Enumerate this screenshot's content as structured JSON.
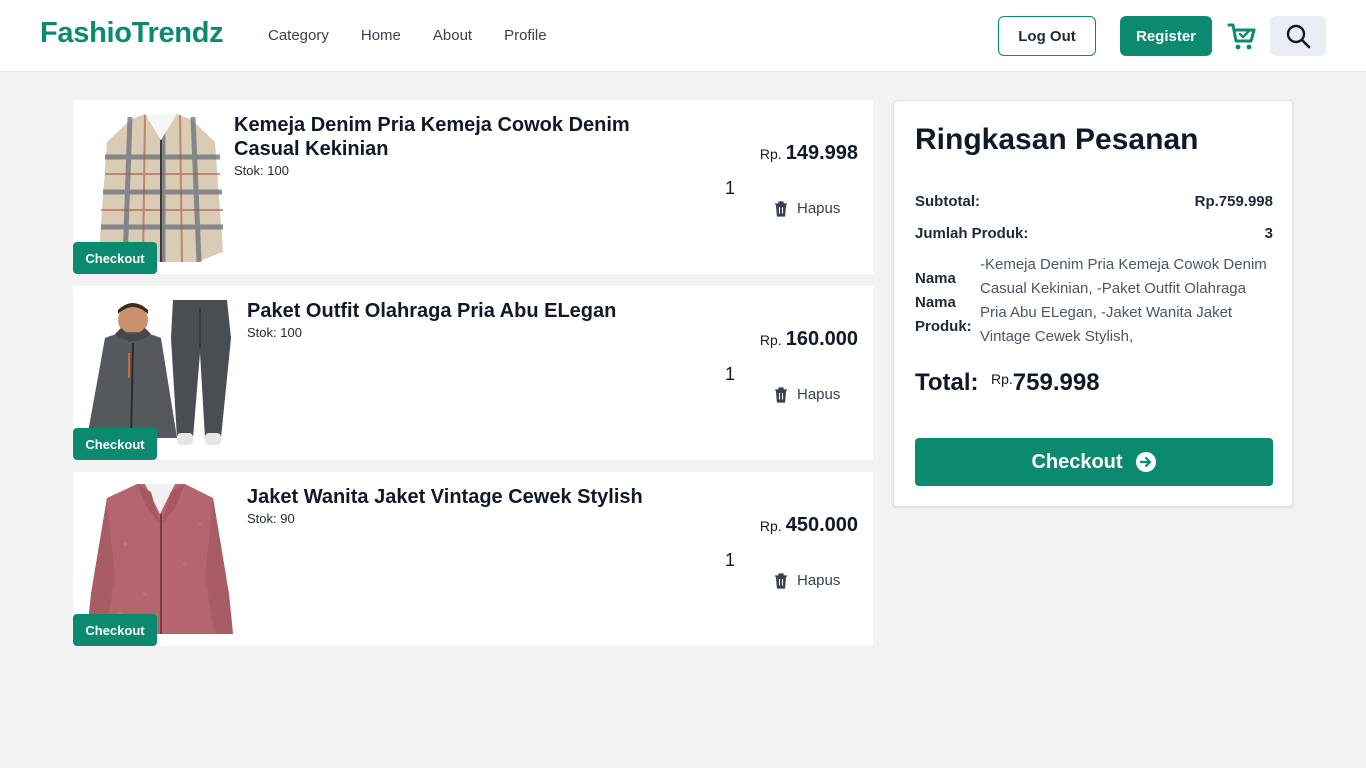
{
  "header": {
    "logo": "FashioTrendz",
    "nav": [
      "Category",
      "Home",
      "About",
      "Profile"
    ],
    "logout_label": "Log Out",
    "register_label": "Register",
    "cart_icon": "cart-icon",
    "search_icon": "search-icon"
  },
  "items": [
    {
      "title": "Kemeja Denim Pria Kemeja Cowok Denim Casual Kekinian",
      "stock": "Stok: 100",
      "price_prefix": "Rp.",
      "price": "149.998",
      "qty": "1",
      "delete_label": "Hapus",
      "checkout_label": "Checkout"
    },
    {
      "title": "Paket Outfit Olahraga Pria Abu ELegan",
      "stock": "Stok: 100",
      "price_prefix": "Rp.",
      "price": "160.000",
      "qty": "1",
      "delete_label": "Hapus",
      "checkout_label": "Checkout"
    },
    {
      "title": "Jaket Wanita Jaket Vintage Cewek Stylish",
      "stock": "Stok: 90",
      "price_prefix": "Rp.",
      "price": "450.000",
      "qty": "1",
      "delete_label": "Hapus",
      "checkout_label": "Checkout"
    }
  ],
  "summary": {
    "title": "Ringkasan Pesanan",
    "subtotal_label": "Subtotal:",
    "subtotal_value": "Rp.759.998",
    "count_label": "Jumlah Produk:",
    "count_value": "3",
    "names_label": "Nama Nama Produk:",
    "names_value": "-Kemeja Denim Pria Kemeja Cowok Denim Casual Kekinian, -Paket Outfit Olahraga Pria Abu ELegan, -Jaket Wanita Jaket Vintage Cewek Stylish,",
    "total_label": "Total:",
    "total_prefix": "Rp.",
    "total_value": "759.998",
    "checkout_label": "Checkout"
  },
  "colors": {
    "brand": "#0b8a6f",
    "background": "#f2f2f2"
  }
}
